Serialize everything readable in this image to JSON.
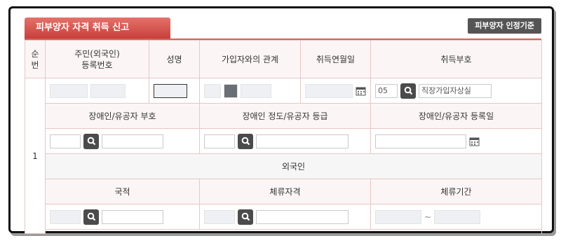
{
  "tab": {
    "title": "피부양자 자격 취득 신고"
  },
  "criteria_button": "피부양자 인정기준",
  "headers": {
    "no": "순번",
    "resident_id": "주민(외국인)\n등록번호",
    "name": "성명",
    "relation": "가입자와의 관계",
    "acq_date": "취득연월일",
    "acq_code": "취득부호"
  },
  "row": {
    "index": "1",
    "acq_code_value": "05",
    "acq_code_desc": "직장가입자상실"
  },
  "disability": {
    "code_label": "장애인/유공자 부호",
    "grade_label": "장애인 정도/유공자 등급",
    "date_label": "장애인/유공자 등록일"
  },
  "foreigner": {
    "section_label": "외국인",
    "nationality_label": "국적",
    "status_label": "체류자격",
    "period_label": "체류기간",
    "period_sep": "~"
  },
  "icons": {
    "search": "search-icon",
    "calendar": "calendar-icon"
  },
  "colors": {
    "tab": "#d9534f",
    "border": "#e6c7c6",
    "header_bg": "#fbf6f5",
    "search_btn": "#4b4b4b"
  }
}
